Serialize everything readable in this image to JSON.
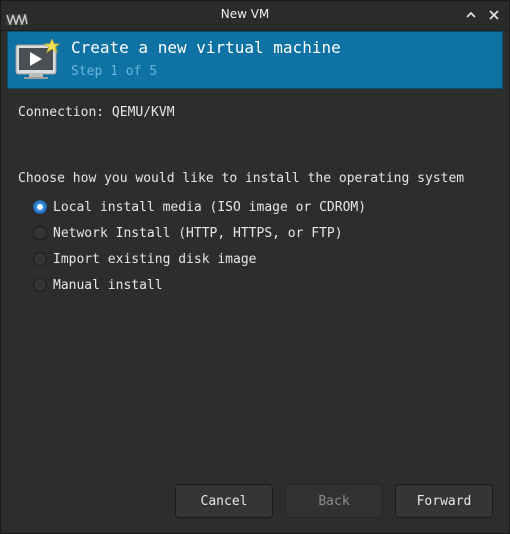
{
  "window": {
    "title": "New VM"
  },
  "banner": {
    "title": "Create a new virtual machine",
    "step": "Step 1 of 5",
    "icon": "monitor-new-vm-icon"
  },
  "connection": {
    "text": "Connection: QEMU/KVM"
  },
  "install": {
    "prompt": "Choose how you would like to install the operating system",
    "options": [
      {
        "label": "Local install media (ISO image or CDROM)",
        "selected": true
      },
      {
        "label": "Network Install (HTTP, HTTPS, or FTP)",
        "selected": false
      },
      {
        "label": "Import existing disk image",
        "selected": false
      },
      {
        "label": "Manual install",
        "selected": false
      }
    ]
  },
  "buttons": {
    "cancel": "Cancel",
    "back": "Back",
    "forward": "Forward"
  },
  "colors": {
    "banner": "#0e72a4",
    "accent": "#2d83d8",
    "background": "#2d2d2d"
  }
}
